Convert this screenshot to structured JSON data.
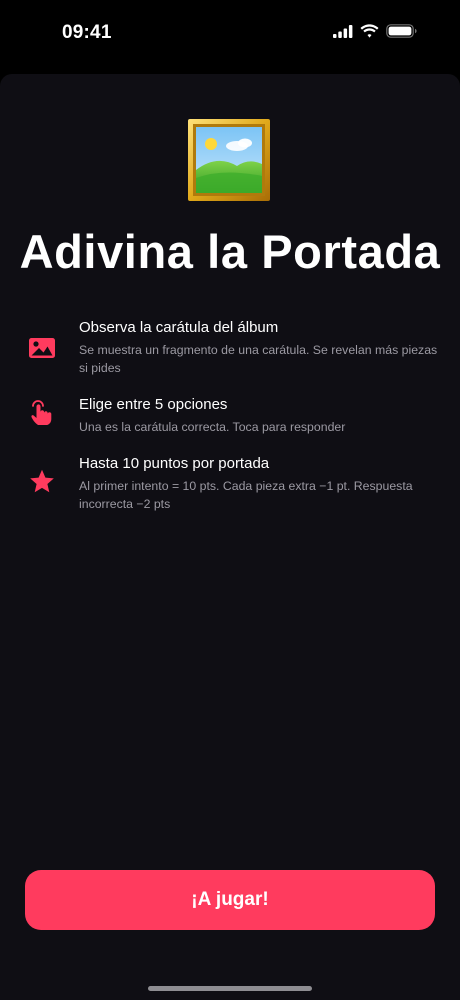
{
  "status_bar": {
    "time": "09:41"
  },
  "hero": {
    "icon": "framed-picture-icon",
    "title": "Adivina la Portada"
  },
  "features": [
    {
      "icon": "image-icon",
      "title": "Observa la carátula del álbum",
      "description": "Se muestra un fragmento de una carátula. Se revelan más piezas si pides"
    },
    {
      "icon": "tap-hand-icon",
      "title": "Elige entre 5 opciones",
      "description": "Una es la carátula correcta. Toca para responder"
    },
    {
      "icon": "star-icon",
      "title": "Hasta 10 puntos por portada",
      "description": "Al primer intento = 10 pts. Cada pieza extra −1 pt. Respuesta incorrecta −2 pts"
    }
  ],
  "play_button": {
    "label": "¡A jugar!"
  },
  "colors": {
    "accent": "#ff3b5e",
    "background": "#0f0e14",
    "secondary_text": "#9c9aa3"
  }
}
